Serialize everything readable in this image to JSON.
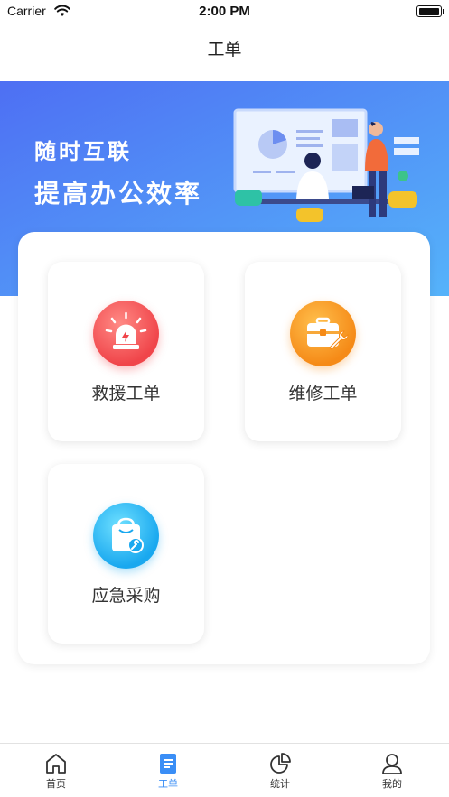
{
  "status_bar": {
    "carrier": "Carrier",
    "time": "2:00 PM"
  },
  "nav": {
    "title": "工单"
  },
  "banner": {
    "line1": "随时互联",
    "line2": "提高办公效率",
    "gradient_start": "#4f78f5",
    "gradient_end": "#53a6f8"
  },
  "tiles": [
    {
      "label": "救援工单",
      "icon": "alarm-siren-icon",
      "color": "#f0454a"
    },
    {
      "label": "维修工单",
      "icon": "toolbox-icon",
      "color": "#f58a17"
    },
    {
      "label": "应急采购",
      "icon": "shopping-bag-wrench-icon",
      "color": "#19a8ef"
    }
  ],
  "tab_bar": {
    "items": [
      {
        "label": "首页",
        "icon": "home-icon",
        "active": false
      },
      {
        "label": "工单",
        "icon": "document-icon",
        "active": true
      },
      {
        "label": "统计",
        "icon": "pie-chart-icon",
        "active": false
      },
      {
        "label": "我的",
        "icon": "user-icon",
        "active": false
      }
    ],
    "active_color": "#3a8ef6",
    "inactive_color": "#333333"
  }
}
